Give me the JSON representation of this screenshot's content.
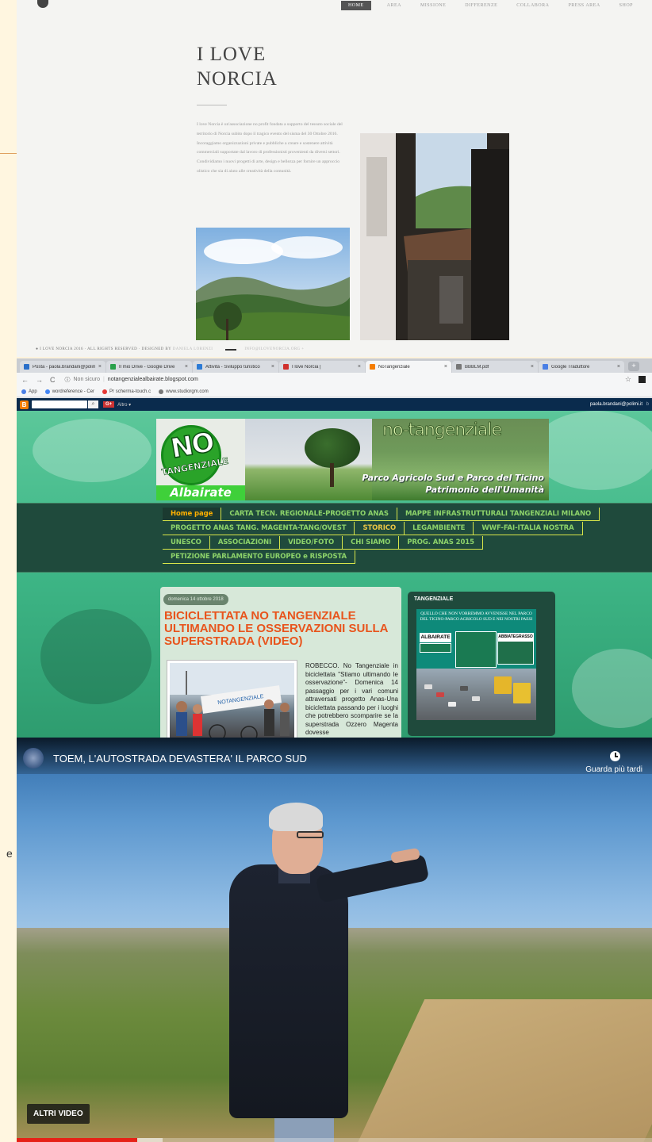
{
  "outer": {
    "edge_glyph": "e"
  },
  "norcia": {
    "nav": [
      "HOME",
      "AREA",
      "MISSIONE",
      "DIFFERENZE",
      "COLLABORA",
      "PRESS AREA",
      "SHOP"
    ],
    "nav_active": "HOME",
    "title_line1": "I LOVE",
    "title_line2": "NORCIA",
    "body": "I love Norcia è un'associazione no profit fondata a supporto del tessuto sociale del territorio di Norcia subito dopo il tragico evento del sisma del 30 Ottobre 2016. Incoraggiamo organizzazioni private e pubbliche a creare e sostenere attività commerciali supportate dal lavoro di professionisti provenienti da diversi settori. Condividiamo i nuovi progetti di arte, design e bellezza per fornire un approccio olistico che sia di aiuto alle creatività della comunità.",
    "footer_text": "● I LOVE NORCIA 2016 · ALL RIGHTS RESERVED · DESIGNED BY",
    "footer_designer": "DANIELA LORENZI",
    "footer_contact": "INFO@ILOVENORCIA.ORG +"
  },
  "browser": {
    "tabs": [
      {
        "label": "Posta - paola.brandani@polimi.it",
        "color": "#2a6fc9",
        "active": false
      },
      {
        "label": "Il mio Drive - Google Drive",
        "color": "#2aa14b",
        "active": false
      },
      {
        "label": "Attività - Sviluppo turistico",
        "color": "#2c7bd6",
        "active": false
      },
      {
        "label": "I love Norcia |",
        "color": "#d0312d",
        "active": false
      },
      {
        "label": "NoTangenziale",
        "color": "#f57d00",
        "active": true
      },
      {
        "label": "BBBLM.pdf",
        "color": "#777777",
        "active": false
      },
      {
        "label": "Google Traduttore",
        "color": "#4a7fe5",
        "active": false
      }
    ],
    "security": "Non sicuro",
    "url": "notangenzialealbairate.blogspot.com",
    "bookmarks": [
      "App",
      "wordreference - Cer",
      "Pr scherma-touch.c",
      "www.studiorgm.com"
    ],
    "blogger_more": "Altro ▾",
    "blogger_user": "paola.brandani@polimi.it",
    "blogger_user_tail": "b"
  },
  "blog": {
    "header_title": "no-tangenziale",
    "header_sub1": "Parco Agricolo Sud e Parco del Ticino",
    "header_sub2": "Patrimonio dell'Umanità",
    "logo_no": "NO",
    "logo_tang": "TANGENZIALE",
    "logo_place": "Albairate",
    "menu_rows": [
      [
        "Home page",
        "CARTA TECN. REGIONALE-PROGETTO ANAS",
        "MAPPE INFRASTRUTTURALI TANGENZIALI MILANO"
      ],
      [
        "PROGETTO ANAS TANG. MAGENTA-TANG/OVEST",
        "STORICO",
        "LEGAMBIENTE",
        "WWF-FAI-ITALIA NOSTRA"
      ],
      [
        "UNESCO",
        "ASSOCIAZIONI",
        "VIDEO/FOTO",
        "CHI SIAMO",
        "PROG. ANAS 2015"
      ],
      [
        "PETIZIONE PARLAMENTO EUROPEO e RISPOSTA"
      ]
    ],
    "post_date": "domenica 14 ottobre 2018",
    "post_title": "BICICLETTATA NO TANGENZIALE ULTIMANDO LE OSSERVAZIONI SULLA SUPERSTRADA (VIDEO)",
    "post_text": "ROBECCO. No Tangenziale in biciclettata \"Stiamo ultimando le osservazione\"- Domenica 14 passaggio per i vari comuni attraversati progetto Anas-Una biciclettata passando per i luoghi che potrebbero scomparire se la superstrada Ozzero Magenta dovesse",
    "side_title": "TANGENZIALE",
    "side_caption": "QUELLO CHE NON VORREMMO AVVENISSE NEL PARCO DEL TICINO-PARCO AGRICOLO SUD E NEI NOSTRI PAESI",
    "side_sign_left": "ALBAIRATE",
    "side_sign_right": "ABBIATEGRASSO"
  },
  "video": {
    "title": "TOEM, L'AUTOSTRADA DEVASTERA' IL PARCO SUD",
    "watch_later": "Guarda più tardi",
    "more_videos": "ALTRI VIDEO",
    "progress_played": 0.19,
    "progress_buffered": 0.23
  }
}
